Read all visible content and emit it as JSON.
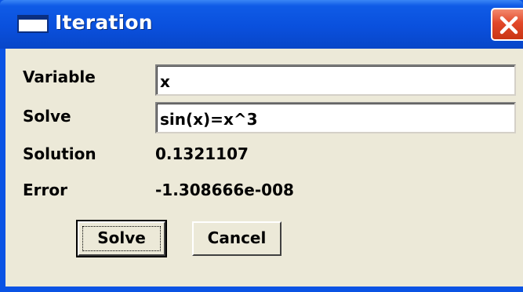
{
  "window": {
    "title": "Iteration",
    "close_label": "Close"
  },
  "form": {
    "variable_label": "Variable",
    "variable_value": "x",
    "solve_label": "Solve",
    "solve_value": "sin(x)=x^3",
    "solution_label": "Solution",
    "solution_value": "0.1321107",
    "error_label": "Error",
    "error_value": "-1.308666e-008"
  },
  "buttons": {
    "solve": "Solve",
    "cancel": "Cancel"
  },
  "colors": {
    "titlebar": "#0a50dd",
    "close_button": "#e2482a",
    "dialog_face": "#ece9d8"
  }
}
